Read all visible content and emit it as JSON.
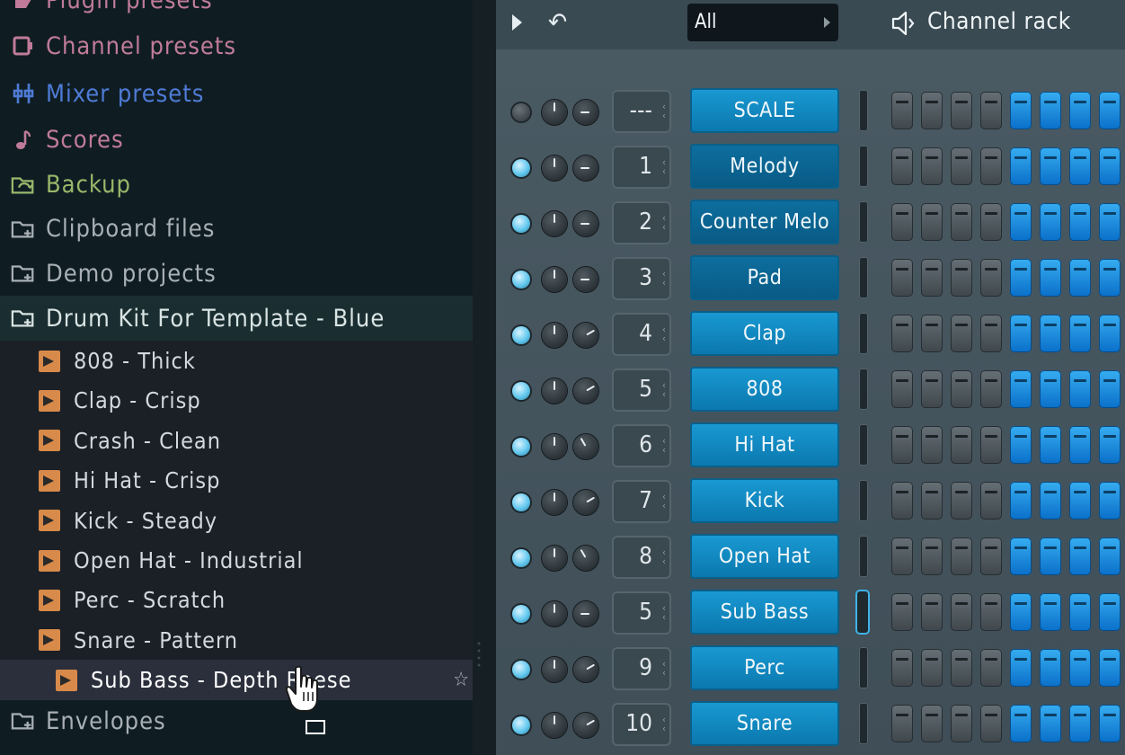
{
  "browser": {
    "top_items": [
      {
        "label": "Plugin presets",
        "icon": "plugin-preset-icon",
        "color": "#c07b9a"
      },
      {
        "label": "Channel presets",
        "icon": "channel-preset-icon",
        "color": "#c07b9a"
      },
      {
        "label": "Mixer presets",
        "icon": "mixer-preset-icon",
        "color": "#4f7bd6"
      },
      {
        "label": "Scores",
        "icon": "music-note-icon",
        "color": "#c07b9a"
      },
      {
        "label": "Backup",
        "icon": "backup-folder-icon",
        "color": "#9ab86a"
      },
      {
        "label": "Clipboard files",
        "icon": "folder-icon",
        "color": "#a8b0b6"
      },
      {
        "label": "Demo projects",
        "icon": "folder-icon",
        "color": "#a8b0b6"
      },
      {
        "label": "Drum Kit For Template - Blue",
        "icon": "folder-open-icon",
        "color": "#d9e4e3"
      }
    ],
    "children": [
      "808 - Thick",
      "Clap - Crisp",
      "Crash - Clean",
      "Hi Hat - Crisp",
      "Kick - Steady",
      "Open Hat - Industrial",
      "Perc - Scratch",
      "Snare - Pattern",
      "Sub Bass - Depth Reese"
    ],
    "bottom_items": [
      {
        "label": "Envelopes",
        "icon": "folder-icon",
        "color": "#a8b0b6"
      }
    ],
    "star": "☆"
  },
  "rack": {
    "filter_label": "All",
    "title": "Channel rack",
    "channels": [
      {
        "num": "---",
        "name": "SCALE",
        "led": false,
        "pan": "pan-c",
        "selected": false,
        "dark": false
      },
      {
        "num": "1",
        "name": "Melody",
        "led": true,
        "pan": "pan-c",
        "selected": false,
        "dark": true
      },
      {
        "num": "2",
        "name": "Counter Melo",
        "led": true,
        "pan": "pan-c",
        "selected": false,
        "dark": true
      },
      {
        "num": "3",
        "name": "Pad",
        "led": true,
        "pan": "pan-c",
        "selected": false,
        "dark": true
      },
      {
        "num": "4",
        "name": "Clap",
        "led": true,
        "pan": "pan-r",
        "selected": false,
        "dark": false
      },
      {
        "num": "5",
        "name": "808",
        "led": true,
        "pan": "pan-r",
        "selected": false,
        "dark": false
      },
      {
        "num": "6",
        "name": "Hi Hat",
        "led": true,
        "pan": "pan-l",
        "selected": false,
        "dark": false
      },
      {
        "num": "7",
        "name": "Kick",
        "led": true,
        "pan": "pan-r",
        "selected": false,
        "dark": false
      },
      {
        "num": "8",
        "name": "Open Hat",
        "led": true,
        "pan": "pan-l",
        "selected": false,
        "dark": false
      },
      {
        "num": "5",
        "name": "Sub Bass",
        "led": true,
        "pan": "pan-c",
        "selected": true,
        "dark": false
      },
      {
        "num": "9",
        "name": "Perc",
        "led": true,
        "pan": "pan-r",
        "selected": false,
        "dark": false
      },
      {
        "num": "10",
        "name": "Snare",
        "led": true,
        "pan": "pan-r",
        "selected": false,
        "dark": false
      }
    ],
    "steps_pattern": [
      false,
      false,
      false,
      false,
      true,
      true,
      true,
      true
    ]
  }
}
